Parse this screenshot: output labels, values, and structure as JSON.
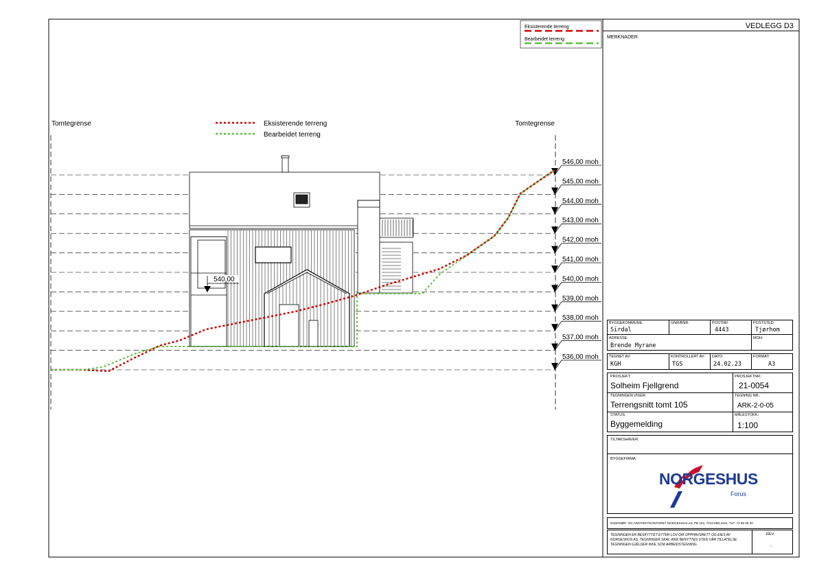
{
  "sheet": {
    "attachment": "VEDLEGG D3",
    "remarks_label": "MERKNADER:"
  },
  "legend_small": {
    "existing": "Eksisterende terreng",
    "modified": "Bearbeidet terreng",
    "existing_color": "#d00000",
    "modified_color": "#5cbf3a"
  },
  "drawing": {
    "boundary_left": "Tomtegrense",
    "boundary_right": "Tomtegrense",
    "legend_existing": "Eksisterende terreng",
    "legend_modified": "Bearbeidet terreng",
    "floor_level": "540,00",
    "levels": [
      "546,00 moh",
      "545,00 moh",
      "544,00 moh",
      "543,00 moh",
      "542,00 moh",
      "541,00 moh",
      "540,00 moh",
      "539,00 moh",
      "538,00 moh",
      "537,00 moh",
      "536,00 moh"
    ]
  },
  "titleblock": {
    "municipality_label": "BYGGEKOMMUNE:",
    "municipality": "Sirdal",
    "gnr_label": "GNR/BNR:",
    "gnr": "",
    "postnr_label": "POSTNR:",
    "postnr": "4443",
    "poststed_label": "POSTSTED:",
    "poststed": "Tjørhom",
    "address_label": "ADRESSE:",
    "address": "Brende Myrane",
    "moh_label": "MOH:",
    "moh": "",
    "drawn_label": "TEGNET AV:",
    "drawn": "KGH",
    "checked_label": "KONTROLLERT AV:",
    "checked": "TGS",
    "date_label": "DATO:",
    "date": "24.02.23",
    "format_label": "FORMAT:",
    "format": "A3",
    "project_label": "PROSJEKT:",
    "project": "Solheim Fjellgrend",
    "projnr_label": "PROSJEKTNR.:",
    "projnr": "21-0054",
    "shows_label": "TEGNINGEN VISER:",
    "shows": "Terrengsnitt tomt 105",
    "drawnr_label": "TEGNING NR.:",
    "drawnr": "ARK-2-0-05",
    "status_label": "STATUS:",
    "status": "Byggemelding",
    "scale_label": "MÅLESTOKK:",
    "scale": "1:100",
    "owner_label": "TILTAKSHAVER:",
    "builder_label": "BYGGEFIRMA:",
    "logo_main": "NORGESHUS",
    "logo_sub": "Forus",
    "office": "INGENIØR- OG ARKITEKTKONTORET NORGESHUS AS,  PB 161, 7223 MELHUS,  TLF: 72 85 68 00",
    "copyright": "TEGNINGEN ER BESKYTTET ETTER LOV OM OPPHAVSRETT OG EIES AV NORGESHUS AS. TEGNINGER SKAL IKKE BENYTTES UTEN VÅR TILLATELSE. TEGNINGEN GJELDER IKKE SOM ARBEIDSTEGNING.",
    "rev_label": "REV.",
    "rev": "."
  }
}
